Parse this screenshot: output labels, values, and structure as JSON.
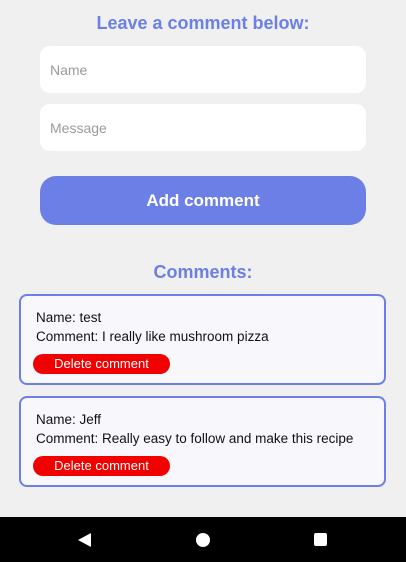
{
  "form": {
    "title": "Leave a comment below:",
    "name_placeholder": "Name",
    "message_placeholder": "Message",
    "add_button_label": "Add comment"
  },
  "comments": {
    "title": "Comments:",
    "items": [
      {
        "name_line": "Name: test",
        "comment_line": "Comment: I really like mushroom pizza",
        "delete_label": "Delete comment"
      },
      {
        "name_line": "Name: Jeff",
        "comment_line": "Comment: Really easy to follow and make this recipe",
        "delete_label": "Delete comment"
      }
    ]
  },
  "nav": {
    "back_icon": "back-triangle-icon",
    "home_icon": "home-circle-icon",
    "recents_icon": "recents-square-icon"
  },
  "colors": {
    "accent": "#6c7fe6",
    "delete": "#f20000",
    "background": "#f0f0f0"
  }
}
